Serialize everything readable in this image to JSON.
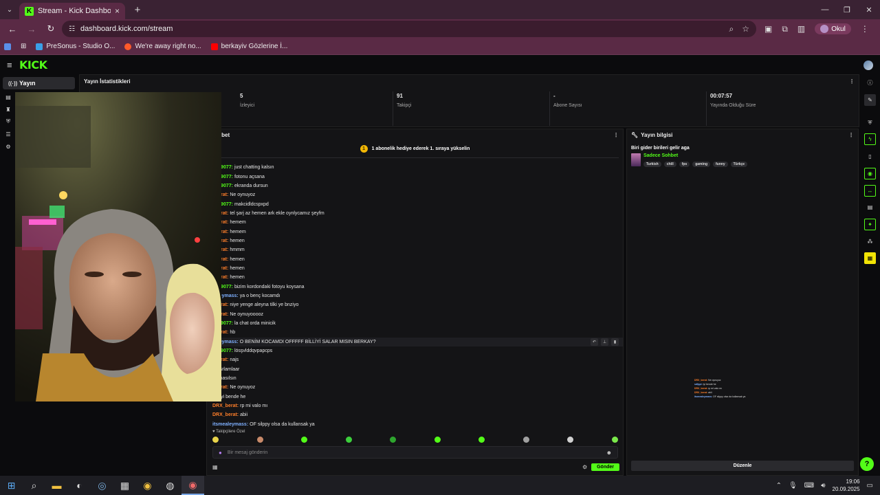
{
  "browser": {
    "tab_title": "Stream - Kick Dashboard",
    "url": "dashboard.kick.com/stream",
    "profile_name": "Okul",
    "bookmarks": [
      {
        "label": "PreSonus - Studio O...",
        "color": "#3aa0e8"
      },
      {
        "label": "We're away right no...",
        "color": "#ff5a2a"
      },
      {
        "label": "berkayiv Gözlerine İ...",
        "color": "#ff0000"
      }
    ]
  },
  "kick": {
    "logo": "KICK",
    "nav": {
      "active_label": "Yayın"
    }
  },
  "stats": {
    "title": "Yayın İstatistikleri",
    "items": [
      {
        "value": "5",
        "label": "İzleyici"
      },
      {
        "value": "91",
        "label": "Takipçi"
      },
      {
        "value": "-",
        "label": "Abone Sayısı"
      },
      {
        "value": "00:07:57",
        "label": "Yayında Olduğu Süre"
      }
    ]
  },
  "chat": {
    "title": "Sohbet",
    "pinned": "1 abonelik hediye ederek 1. sıraya yükselin",
    "pin_rank": "1",
    "messages": [
      {
        "user": "ad19077:",
        "text": "just chatting kalsın",
        "color": "#53fc18"
      },
      {
        "user": "ad19077:",
        "text": "fotonu açsana",
        "color": "#53fc18"
      },
      {
        "user": "ad19077:",
        "text": "ekranda dursun",
        "color": "#53fc18"
      },
      {
        "user": "_berat:",
        "text": "Ne oynuyoz",
        "color": "#ff7f2a"
      },
      {
        "user": "ad19077:",
        "text": "makcidldcspxpd",
        "color": "#53fc18"
      },
      {
        "user": "_berat:",
        "text": "tel şarj az hemen ark ekle oynlycamız şeyfm",
        "color": "#ff7f2a"
      },
      {
        "user": "_berat:",
        "text": "hemem",
        "color": "#ff7f2a"
      },
      {
        "user": "_berat:",
        "text": "hemem",
        "color": "#ff7f2a"
      },
      {
        "user": "_berat:",
        "text": "hemen",
        "color": "#ff7f2a"
      },
      {
        "user": "_berat:",
        "text": "hmmm",
        "color": "#ff7f2a"
      },
      {
        "user": "_berat:",
        "text": "hemen",
        "color": "#ff7f2a"
      },
      {
        "user": "_berat:",
        "text": "hemen",
        "color": "#ff7f2a"
      },
      {
        "user": "_berat:",
        "text": "hemen",
        "color": "#ff7f2a"
      },
      {
        "user": "ad19077:",
        "text": "bizim kordondaki fotoyu koysana",
        "color": "#53fc18"
      },
      {
        "user": "ealeymass:",
        "text": "ya o benç kocamdı",
        "color": "#7fb0ff"
      },
      {
        "user": "_berat:",
        "text": "niye yenge aleyna tilki ye bnziyo",
        "color": "#ff7f2a"
      },
      {
        "user": "_berat:",
        "text": "Ne oynuyooooz",
        "color": "#ff7f2a"
      },
      {
        "user": "ad19077:",
        "text": "la chat orda minicik",
        "color": "#53fc18"
      },
      {
        "user": "_berat:",
        "text": "hb",
        "color": "#ff7f2a"
      },
      {
        "user": "ealeymass:",
        "text": "O BENİM KOCAMDI OFFFFF BİLLİYİ SALAR MISIN BERKAY?",
        "color": "#7fb0ff"
      },
      {
        "user": "ad19077:",
        "text": "lösşvlddqvpapcps",
        "color": "#53fc18"
      },
      {
        "user": "_berat:",
        "text": "najs",
        "color": "#ff7f2a"
      },
      {
        "user": "pi:",
        "text": "srlamlaar",
        "color": "#7fb0ff"
      },
      {
        "user": "pi:",
        "text": "nasılsın",
        "color": "#7fb0ff"
      },
      {
        "user": "_berat:",
        "text": "Ne oynuyoz",
        "color": "#ff7f2a"
      },
      {
        "user": "pi:",
        "text": "iyi bende he",
        "color": "#7fb0ff"
      },
      {
        "user": "DRX_berat:",
        "text": "rp mi valo mı",
        "color": "#ff7f2a"
      },
      {
        "user": "DRX_berat:",
        "text": "abii",
        "color": "#ff7f2a"
      },
      {
        "user": "itsmealeymass:",
        "text": "OF silppy olsa da kullansak ya",
        "color": "#7fb0ff"
      }
    ],
    "emote_section_label": "♥ Takipçilere Özel",
    "input_placeholder": "Bir mesaj gönderin",
    "send_label": "Gönder"
  },
  "info": {
    "title": "Yayın bilgisi",
    "stream_title": "Biri gider birileri gelir aga",
    "category": "Sadece Sohbet",
    "tags": [
      "Turkish",
      "chill",
      "fps",
      "gaming",
      "funny",
      "Türkçe"
    ],
    "preview_messages": [
      {
        "user": "DRX_berat:",
        "text": "Ne oynuyoz",
        "color": "#ff7f2a"
      },
      {
        "user": "sdfppi:",
        "text": "iyi bende he",
        "color": "#7fb0ff"
      },
      {
        "user": "DRX_berat:",
        "text": "rp mi valo mı",
        "color": "#ff7f2a"
      },
      {
        "user": "DRX_berat:",
        "text": "abii",
        "color": "#ff7f2a"
      },
      {
        "user": "itsmealeymass:",
        "text": "OF silppy olsa da kullansak ya",
        "color": "#7fb0ff"
      }
    ],
    "edit_label": "Düzenle"
  },
  "taskbar": {
    "time": "19:06",
    "date": "20.09.2025"
  },
  "colors": {
    "kick_green": "#53fc18",
    "browser_frame": "#5a2a45"
  }
}
